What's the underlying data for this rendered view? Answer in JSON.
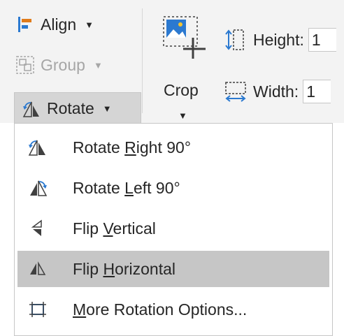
{
  "ribbon": {
    "align": {
      "label": "Align",
      "icon": "align-icon"
    },
    "group": {
      "label": "Group",
      "icon": "group-icon",
      "disabled": true
    },
    "rotate": {
      "label": "Rotate",
      "icon": "rotate-icon"
    },
    "crop": {
      "label": "Crop",
      "icon": "crop-icon"
    },
    "height": {
      "label": "Height:",
      "value": "1",
      "icon": "height-icon"
    },
    "width": {
      "label": "Width:",
      "value": "1",
      "icon": "width-icon"
    }
  },
  "rotate_menu": {
    "items": [
      {
        "pre": "Rotate ",
        "accel": "R",
        "post": "ight 90°",
        "icon": "rotate-right-icon",
        "highlighted": false
      },
      {
        "pre": "Rotate ",
        "accel": "L",
        "post": "eft 90°",
        "icon": "rotate-left-icon",
        "highlighted": false
      },
      {
        "pre": "Flip ",
        "accel": "V",
        "post": "ertical",
        "icon": "flip-vertical-icon",
        "highlighted": false
      },
      {
        "pre": "Flip ",
        "accel": "H",
        "post": "orizontal",
        "icon": "flip-horizontal-icon",
        "highlighted": true
      },
      {
        "pre": "",
        "accel": "M",
        "post": "ore Rotation Options...",
        "icon": "more-rotation-options-icon",
        "highlighted": false
      }
    ]
  },
  "colors": {
    "accent_blue": "#2b79d0",
    "dark_gray": "#404040",
    "highlight": "#c6c6c6"
  }
}
